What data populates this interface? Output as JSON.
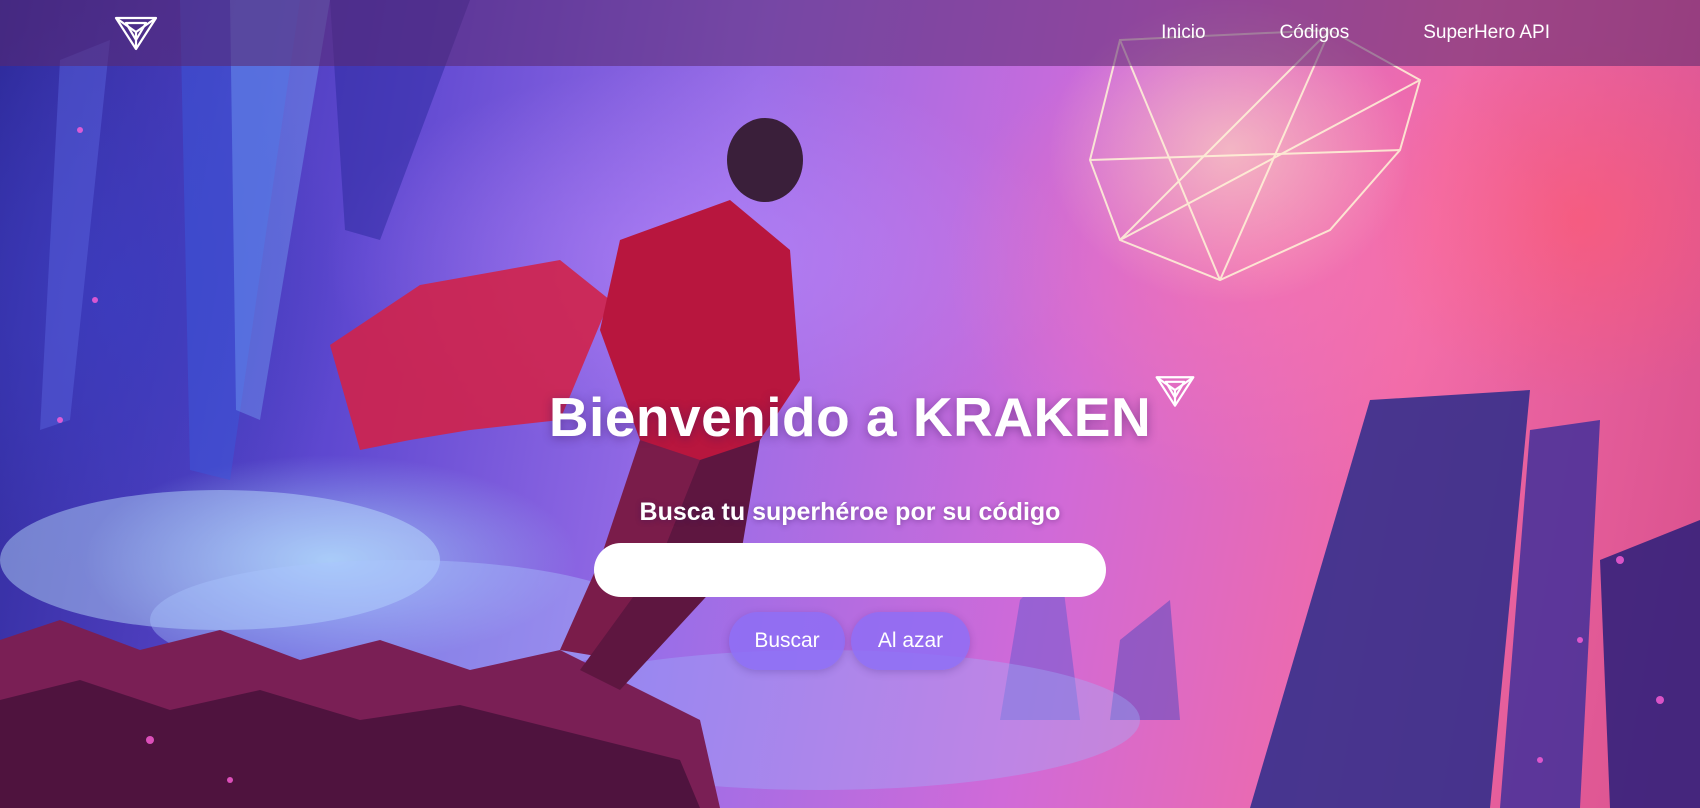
{
  "nav": {
    "logo_icon": "geometric-diamond-logo-icon",
    "links": [
      "Inicio",
      "Códigos",
      "SuperHero API"
    ]
  },
  "hero": {
    "title": "Bienvenido a KRAKEN",
    "title_icon": "geometric-diamond-logo-icon",
    "subtitle": "Busca tu superhéroe por su código",
    "search_value": "",
    "search_placeholder": "",
    "search_button": "Buscar",
    "random_button": "Al azar"
  },
  "colors": {
    "navbar": "#5a286e",
    "button": "#8c6ef5",
    "text": "#ffffff"
  }
}
